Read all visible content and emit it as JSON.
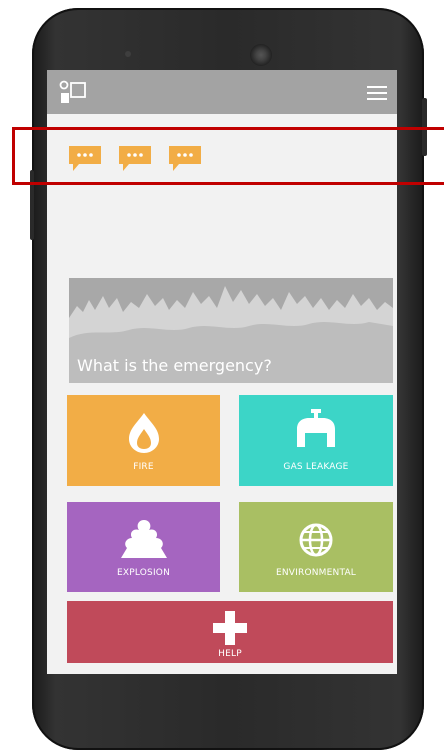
{
  "app": {
    "logo_icon": "app-logo-icon",
    "menu_icon": "hamburger-menu-icon"
  },
  "chat_bubbles": [
    {
      "icon": "chat-bubble-icon",
      "text": "..."
    },
    {
      "icon": "chat-bubble-icon",
      "text": "..."
    },
    {
      "icon": "chat-bubble-icon",
      "text": "..."
    }
  ],
  "banner": {
    "title": "What is the emergency?"
  },
  "tiles": {
    "fire": {
      "label": "FIRE",
      "icon": "flame-icon",
      "color": "#f2ad46"
    },
    "gas": {
      "label": "GAS LEAKAGE",
      "icon": "faucet-icon",
      "color": "#3cd5c7"
    },
    "explosion": {
      "label": "EXPLOSION",
      "icon": "explosion-icon",
      "color": "#a565c0"
    },
    "environmental": {
      "label": "ENVIRONMENTAL",
      "icon": "globe-icon",
      "color": "#a9bf63"
    },
    "help": {
      "label": "HELP",
      "icon": "plus-icon",
      "color": "#c04a5a"
    }
  },
  "colors": {
    "appbar": "#a3a3a3",
    "bubble": "#f2ad46",
    "highlight": "#c00000"
  }
}
